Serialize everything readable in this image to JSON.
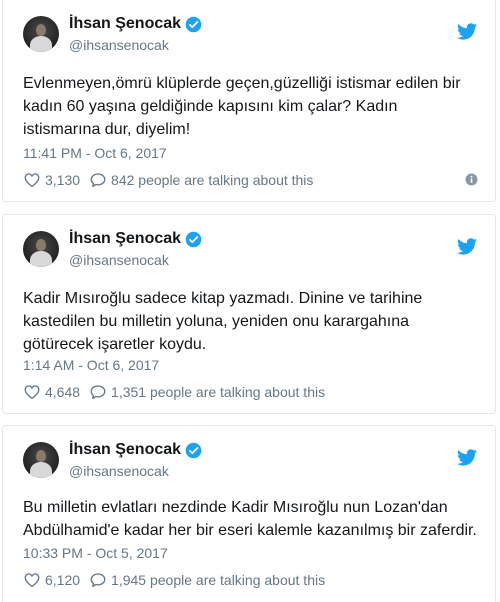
{
  "tweets": [
    {
      "name": "İhsan Şenocak",
      "handle": "@ihsansenocak",
      "text": "Evlenmeyen,ömrü klüplerde geçen,güzelliği istismar edilen bir kadın 60 yaşına geldiğinde kapısını kim çalar? Kadın istismarına dur, diyelim!",
      "time": "11:41 PM - Oct 6, 2017",
      "likes": "3,130",
      "talking": "842 people are talking about this"
    },
    {
      "name": "İhsan Şenocak",
      "handle": "@ihsansenocak",
      "text": "Kadir Mısıroğlu sadece kitap yazmadı. Dinine ve tarihine kastedilen bu milletin yoluna, yeniden onu karargahına götürecek işaretler koydu.",
      "time": "1:14 AM - Oct 6, 2017",
      "likes": "4,648",
      "talking": "1,351 people are talking about this"
    },
    {
      "name": "İhsan Şenocak",
      "handle": "@ihsansenocak",
      "text": "Bu milletin evlatları nezdinde Kadir Mısıroğlu nun Lozan'dan Abdülhamid'e kadar her bir eseri kalemle kazanılmış bir zaferdir.",
      "time": "10:33 PM - Oct 5, 2017",
      "likes": "6,120",
      "talking": "1,945 people are talking about this"
    }
  ],
  "icons": {
    "verified": "verified-badge-icon",
    "bird": "twitter-bird-icon",
    "like": "heart-icon",
    "reply": "speech-bubble-icon",
    "info": "info-icon"
  },
  "colors": {
    "twitter_blue": "#1da1f2",
    "secondary_text": "#657786",
    "border": "#e1e8ed"
  }
}
